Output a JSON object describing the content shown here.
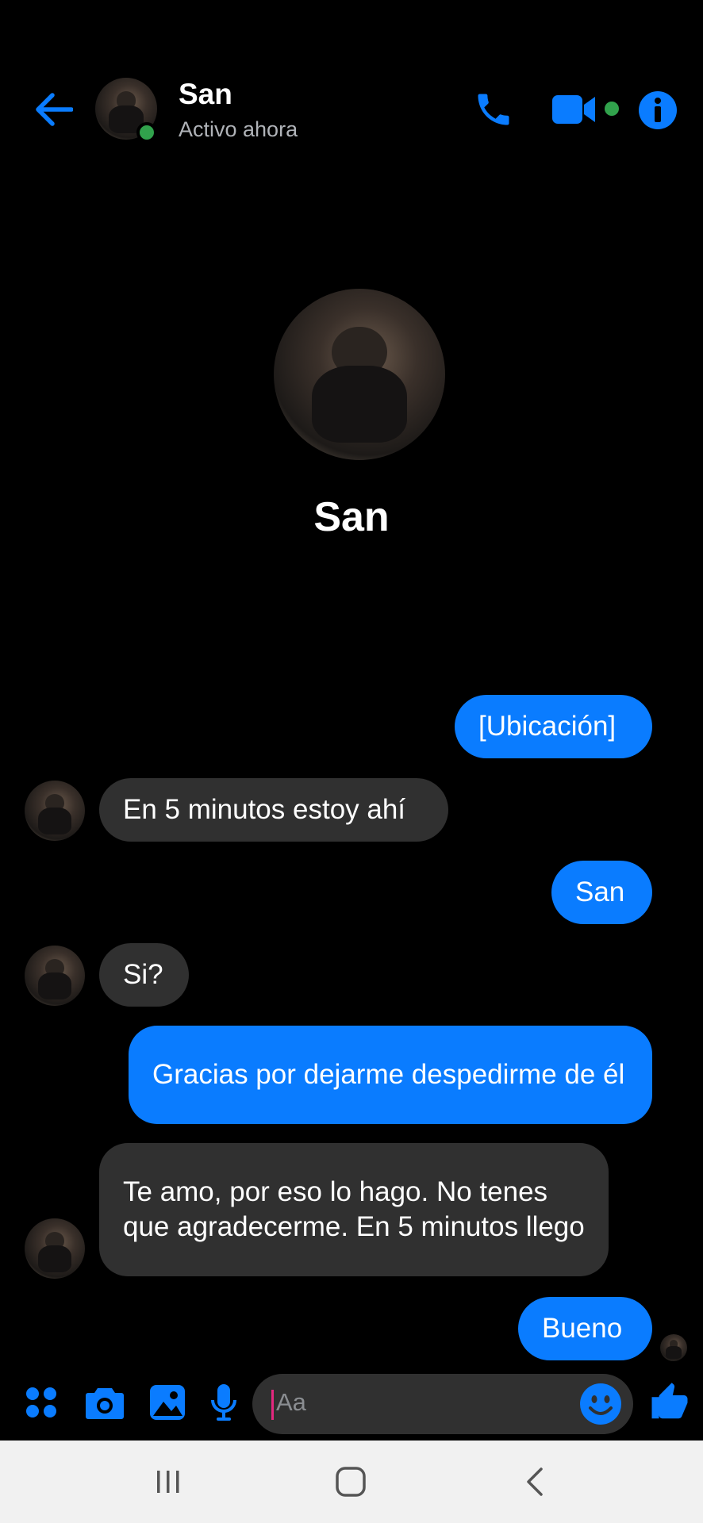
{
  "header": {
    "contact_name": "San",
    "status": "Activo ahora"
  },
  "profile": {
    "name": "San"
  },
  "messages": [
    {
      "direction": "out",
      "text": "[Ubicación]"
    },
    {
      "direction": "in",
      "text": "En 5 minutos estoy ahí"
    },
    {
      "direction": "out",
      "text": "San"
    },
    {
      "direction": "in",
      "text": "Si?"
    },
    {
      "direction": "out",
      "text": "Gracias por dejarme despedirme de él"
    },
    {
      "direction": "in",
      "text": "Te amo, por eso lo hago. No tenes que agradecerme. En 5 minutos llego"
    },
    {
      "direction": "out",
      "text": "Bueno"
    }
  ],
  "composer": {
    "placeholder": "Aa"
  },
  "colors": {
    "accent": "#0a7cff",
    "online": "#31a24c",
    "incoming_bubble": "#303030",
    "background": "#000000"
  },
  "icons": [
    "back-arrow-icon",
    "phone-icon",
    "video-camera-icon",
    "info-icon",
    "apps-icon",
    "camera-icon",
    "gallery-icon",
    "microphone-icon",
    "emoji-icon",
    "thumbs-up-icon",
    "recents-icon",
    "home-icon",
    "back-icon"
  ]
}
